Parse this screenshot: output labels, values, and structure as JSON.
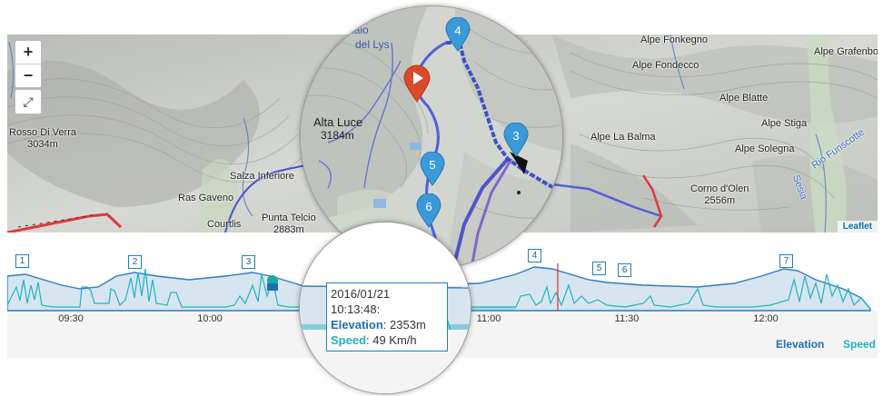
{
  "map": {
    "zoom_in": "+",
    "zoom_out": "−",
    "fullscreen_icon": "⤢",
    "attribution": "Leaflet",
    "places": {
      "rosso": "Rosso Di Verra",
      "rosso_ele": "3034m",
      "ras_gaveno": "Ras Gaveno",
      "salza": "Salza Inferiore",
      "courtlis": "Courtlis",
      "punta_telcio": "Punta Telcio",
      "punta_telcio_ele": "2883m",
      "alta_luce": "Alta Luce",
      "alta_luce_ele": "3184m",
      "ghiacciaio": "hiacciaio",
      "del_lys": "del Lys",
      "fonkegno": "Alpe Fonkegno",
      "grafenbo": "Alpe Grafenbo",
      "fondecco": "Alpe Fondecco",
      "blatte": "Alpe Blatte",
      "stiga": "Alpe Stiga",
      "la_balma": "Alpe La Balma",
      "solegna": "Alpe Solegna",
      "corno_olen": "Corno d'Olen",
      "corno_olen_ele": "2556m",
      "rio_funscotte": "Rio Funscotte",
      "sesia": "Sesia"
    },
    "markers": [
      "4",
      "3",
      "5",
      "6"
    ],
    "start_icon": "play-icon"
  },
  "chart": {
    "waypoints": [
      "1",
      "2",
      "3",
      "4",
      "5",
      "6",
      "7"
    ],
    "time_ticks": [
      "09:30",
      "10:00",
      "11:00",
      "11:30",
      "12:00"
    ],
    "legend": {
      "elevation": "Elevation",
      "speed": "Speed"
    },
    "colors": {
      "elevation": "#1f6fb0",
      "speed": "#22b2c0",
      "cursor": "#e03030"
    }
  },
  "tooltip": {
    "date": "2016/01/21",
    "time": "10:13:48:",
    "elevation_label": "Elevation",
    "elevation_value": ": 2353m",
    "speed_label": "Speed",
    "speed_value": ": 49 Km/h"
  }
}
